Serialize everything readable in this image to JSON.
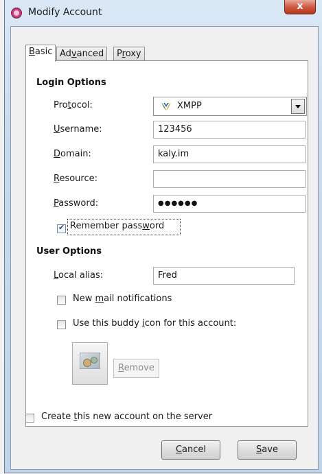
{
  "window": {
    "title": "Modify Account",
    "close_glyph": "x"
  },
  "tabs": [
    {
      "label_pre": "",
      "mnemonic": "B",
      "label_post": "asic",
      "active": true
    },
    {
      "label_pre": "Ad",
      "mnemonic": "v",
      "label_post": "anced",
      "active": false
    },
    {
      "label_pre": "P",
      "mnemonic": "r",
      "label_post": "oxy",
      "active": false
    }
  ],
  "login_options": {
    "title": "Login Options",
    "protocol": {
      "label_pre": "Pro",
      "mnemonic": "t",
      "label_post": "ocol:",
      "value": "XMPP",
      "icon": "xmpp-icon"
    },
    "username": {
      "label_pre": "",
      "mnemonic": "U",
      "label_post": "sername:",
      "value": "123456"
    },
    "domain": {
      "label_pre": "",
      "mnemonic": "D",
      "label_post": "omain:",
      "value": "kaly.im"
    },
    "resource": {
      "label_pre": "",
      "mnemonic": "R",
      "label_post": "esource:",
      "value": ""
    },
    "password": {
      "label_pre": "",
      "mnemonic": "P",
      "label_post": "assword:",
      "value": "●●●●●●"
    },
    "remember": {
      "label_pre": "Remember pass",
      "mnemonic": "w",
      "label_post": "ord",
      "checked": true
    }
  },
  "user_options": {
    "title": "User Options",
    "local_alias": {
      "label_pre": "",
      "mnemonic": "L",
      "label_post": "ocal alias:",
      "value": "Fred"
    },
    "new_mail": {
      "label_pre": "New ",
      "mnemonic": "m",
      "label_post": "ail notifications",
      "checked": false
    },
    "buddy_icon": {
      "label_pre": "Use this buddy ",
      "mnemonic": "i",
      "label_post": "con for this account:",
      "checked": false
    },
    "remove": {
      "label_pre": "",
      "mnemonic": "R",
      "label_post": "emove"
    }
  },
  "create_account": {
    "label_pre": "Create ",
    "mnemonic": "t",
    "label_post": "his new account on the server",
    "checked": false
  },
  "buttons": {
    "cancel": {
      "label_pre": "",
      "mnemonic": "C",
      "label_post": "ancel"
    },
    "save": {
      "label_pre": "",
      "mnemonic": "S",
      "label_post": "ave"
    }
  },
  "colors": {
    "xmpp_icon_green": "#3d8b24",
    "xmpp_icon_orange": "#e08a1e",
    "title_bar": "#c9dbee",
    "close_red": "#cf5b43"
  }
}
